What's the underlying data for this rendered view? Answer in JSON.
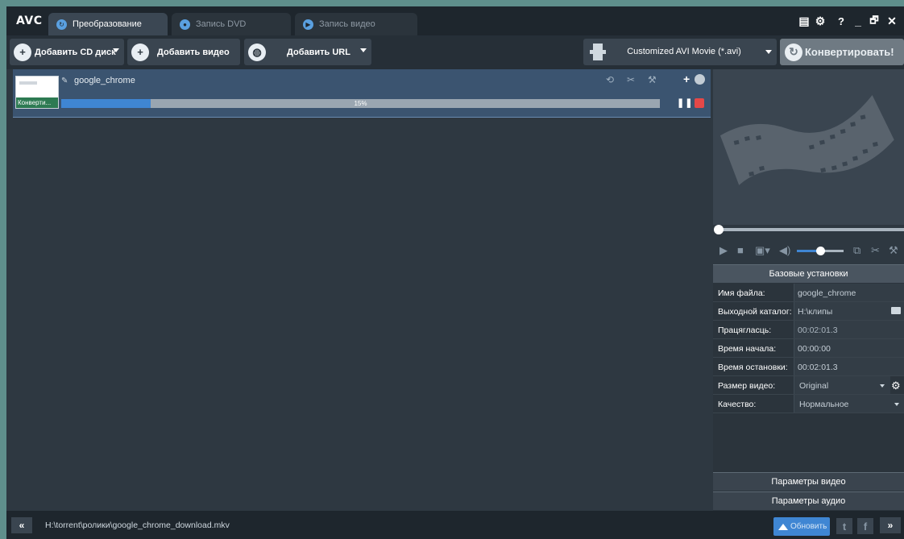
{
  "app": {
    "logo": "AVC"
  },
  "tabs": [
    {
      "label": "Преобразование",
      "icon": "convert-tab-icon",
      "active": true
    },
    {
      "label": "Запись DVD",
      "icon": "disc-icon",
      "active": false
    },
    {
      "label": "Запись видео",
      "icon": "record-icon",
      "active": false
    }
  ],
  "window_controls": {
    "skin": "▤",
    "settings": "⚙",
    "help": "?",
    "minimize": "_",
    "restore": "🗗",
    "close": "✕"
  },
  "toolbar": {
    "add_cd": "Добавить CD диск",
    "add_video": "Добавить видео",
    "add_url": "Добавить URL",
    "profile": "Customized AVI Movie (*.avi)",
    "convert": "Конвертировать!"
  },
  "file": {
    "name": "google_chrome",
    "thumb_status": "Конверти...",
    "progress_label": "15%",
    "progress_value": 15
  },
  "settings": {
    "header": "Базовые установки",
    "rows": [
      {
        "label": "Имя файла:",
        "value": "google_chrome"
      },
      {
        "label": "Выходной каталог:",
        "value": "H:\\клипы"
      },
      {
        "label": "Працягласць:",
        "value": "00:02:01.3"
      },
      {
        "label": "Время начала:",
        "value": "00:00:00"
      },
      {
        "label": "Время остановки:",
        "value": "00:02:01.3"
      },
      {
        "label": "Размер видео:",
        "value": "Original"
      },
      {
        "label": "Качество:",
        "value": "Нормальное"
      }
    ],
    "video_params": "Параметры видео",
    "audio_params": "Параметры аудио"
  },
  "status": {
    "prev": "«",
    "path": "H:\\torrent\\ролики\\google_chrome_download.mkv",
    "update": "Обновить",
    "next": "»"
  },
  "colors": {
    "accent": "#3f86d3",
    "stop": "#e54848",
    "active_tab": "#3b4753"
  }
}
